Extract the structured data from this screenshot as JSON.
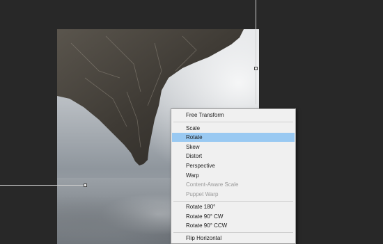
{
  "context_menu": {
    "items": [
      {
        "label": "Free Transform",
        "selected": false,
        "disabled": false
      },
      {
        "label": "Scale",
        "selected": false,
        "disabled": false
      },
      {
        "label": "Rotate",
        "selected": true,
        "disabled": false
      },
      {
        "label": "Skew",
        "selected": false,
        "disabled": false
      },
      {
        "label": "Distort",
        "selected": false,
        "disabled": false
      },
      {
        "label": "Perspective",
        "selected": false,
        "disabled": false
      },
      {
        "label": "Warp",
        "selected": false,
        "disabled": false
      },
      {
        "label": "Content-Aware Scale",
        "selected": false,
        "disabled": true
      },
      {
        "label": "Puppet Warp",
        "selected": false,
        "disabled": true
      },
      {
        "label": "Rotate 180°",
        "selected": false,
        "disabled": false
      },
      {
        "label": "Rotate 90° CW",
        "selected": false,
        "disabled": false
      },
      {
        "label": "Rotate 90° CCW",
        "selected": false,
        "disabled": false
      },
      {
        "label": "Flip Horizontal",
        "selected": false,
        "disabled": false
      }
    ]
  },
  "colors": {
    "workspace": "#282828",
    "menu_background": "#f0f0f0",
    "menu_highlight": "#99c9f2",
    "disabled_text": "#9a9a9a"
  }
}
